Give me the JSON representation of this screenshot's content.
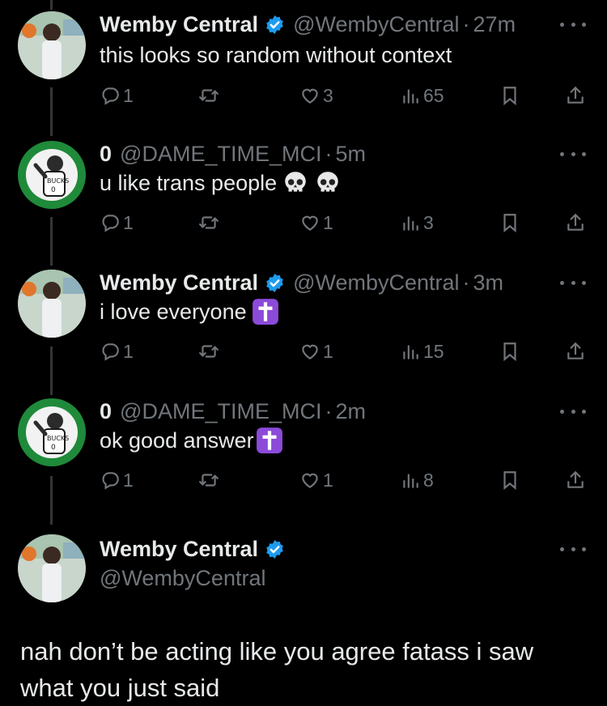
{
  "tweets": [
    {
      "author": "Wemby Central",
      "verified": true,
      "handle": "@WembyCentral",
      "time": "27m",
      "text": "this looks so random without context",
      "emoji": [],
      "replies": "1",
      "reposts": "",
      "likes": "3",
      "views": "65",
      "avatar": "wemby"
    },
    {
      "author": "0",
      "verified": false,
      "handle": "@DAME_TIME_MCI",
      "time": "5m",
      "text": "u like trans people",
      "emoji": [
        "skull-emoji",
        "skull-emoji"
      ],
      "replies": "1",
      "reposts": "",
      "likes": "1",
      "views": "3",
      "avatar": "dame"
    },
    {
      "author": "Wemby Central",
      "verified": true,
      "handle": "@WembyCentral",
      "time": "3m",
      "text": "i love everyone",
      "emoji": [
        "latin-cross-emoji"
      ],
      "replies": "1",
      "reposts": "",
      "likes": "1",
      "views": "15",
      "avatar": "wemby"
    },
    {
      "author": "0",
      "verified": false,
      "handle": "@DAME_TIME_MCI",
      "time": "2m",
      "text": "ok good answer",
      "emoji": [
        "latin-cross-emoji"
      ],
      "replies": "1",
      "reposts": "",
      "likes": "1",
      "views": "8",
      "avatar": "dame"
    }
  ],
  "main_tweet": {
    "author": "Wemby Central",
    "verified": true,
    "handle": "@WembyCentral",
    "text": "nah don’t be acting like you agree fatass i saw what you just said"
  },
  "colors": {
    "background": "#000000",
    "text": "#e7e9ea",
    "muted": "#71767b",
    "verified": "#1d9bf0",
    "thread_line": "#333639",
    "cross_emoji_bg": "#8c4ad9"
  }
}
